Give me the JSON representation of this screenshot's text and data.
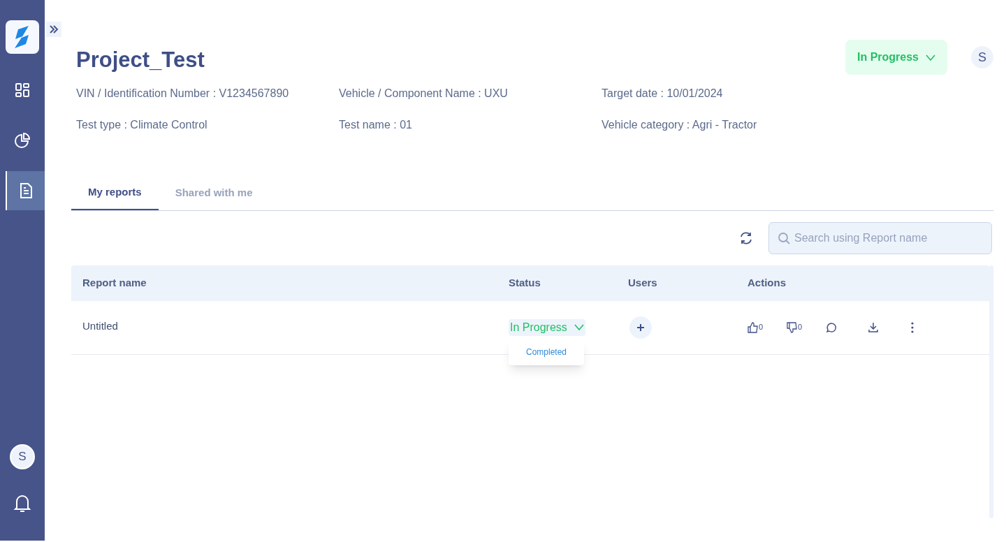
{
  "sidebar": {
    "nav_items": [
      {
        "kind": "dashboard",
        "selected": false
      },
      {
        "kind": "chart",
        "selected": false
      },
      {
        "kind": "report",
        "selected": true
      }
    ],
    "avatar": "S"
  },
  "header": {
    "title": "Project_Test",
    "status": "In Progress",
    "avatar": "S"
  },
  "details": [
    "VIN / Identification Number : V1234567890",
    "Vehicle / Component Name : UXU",
    "Target date : 10/01/2024",
    "Test type : Climate Control",
    "Test name : 01",
    "Vehicle category : Agri - Tractor"
  ],
  "tabs": [
    {
      "label": "My reports",
      "selected": true
    },
    {
      "label": "Shared with me",
      "selected": false
    }
  ],
  "search": {
    "placeholder": "Search using Report name"
  },
  "table": {
    "columns": [
      "Report name",
      "Status",
      "Users",
      "Actions"
    ],
    "rows": [
      {
        "name": "Untitled",
        "status": "In Progress",
        "likes": "0",
        "dislikes": "0",
        "status_menu": [
          "Completed"
        ]
      }
    ]
  }
}
